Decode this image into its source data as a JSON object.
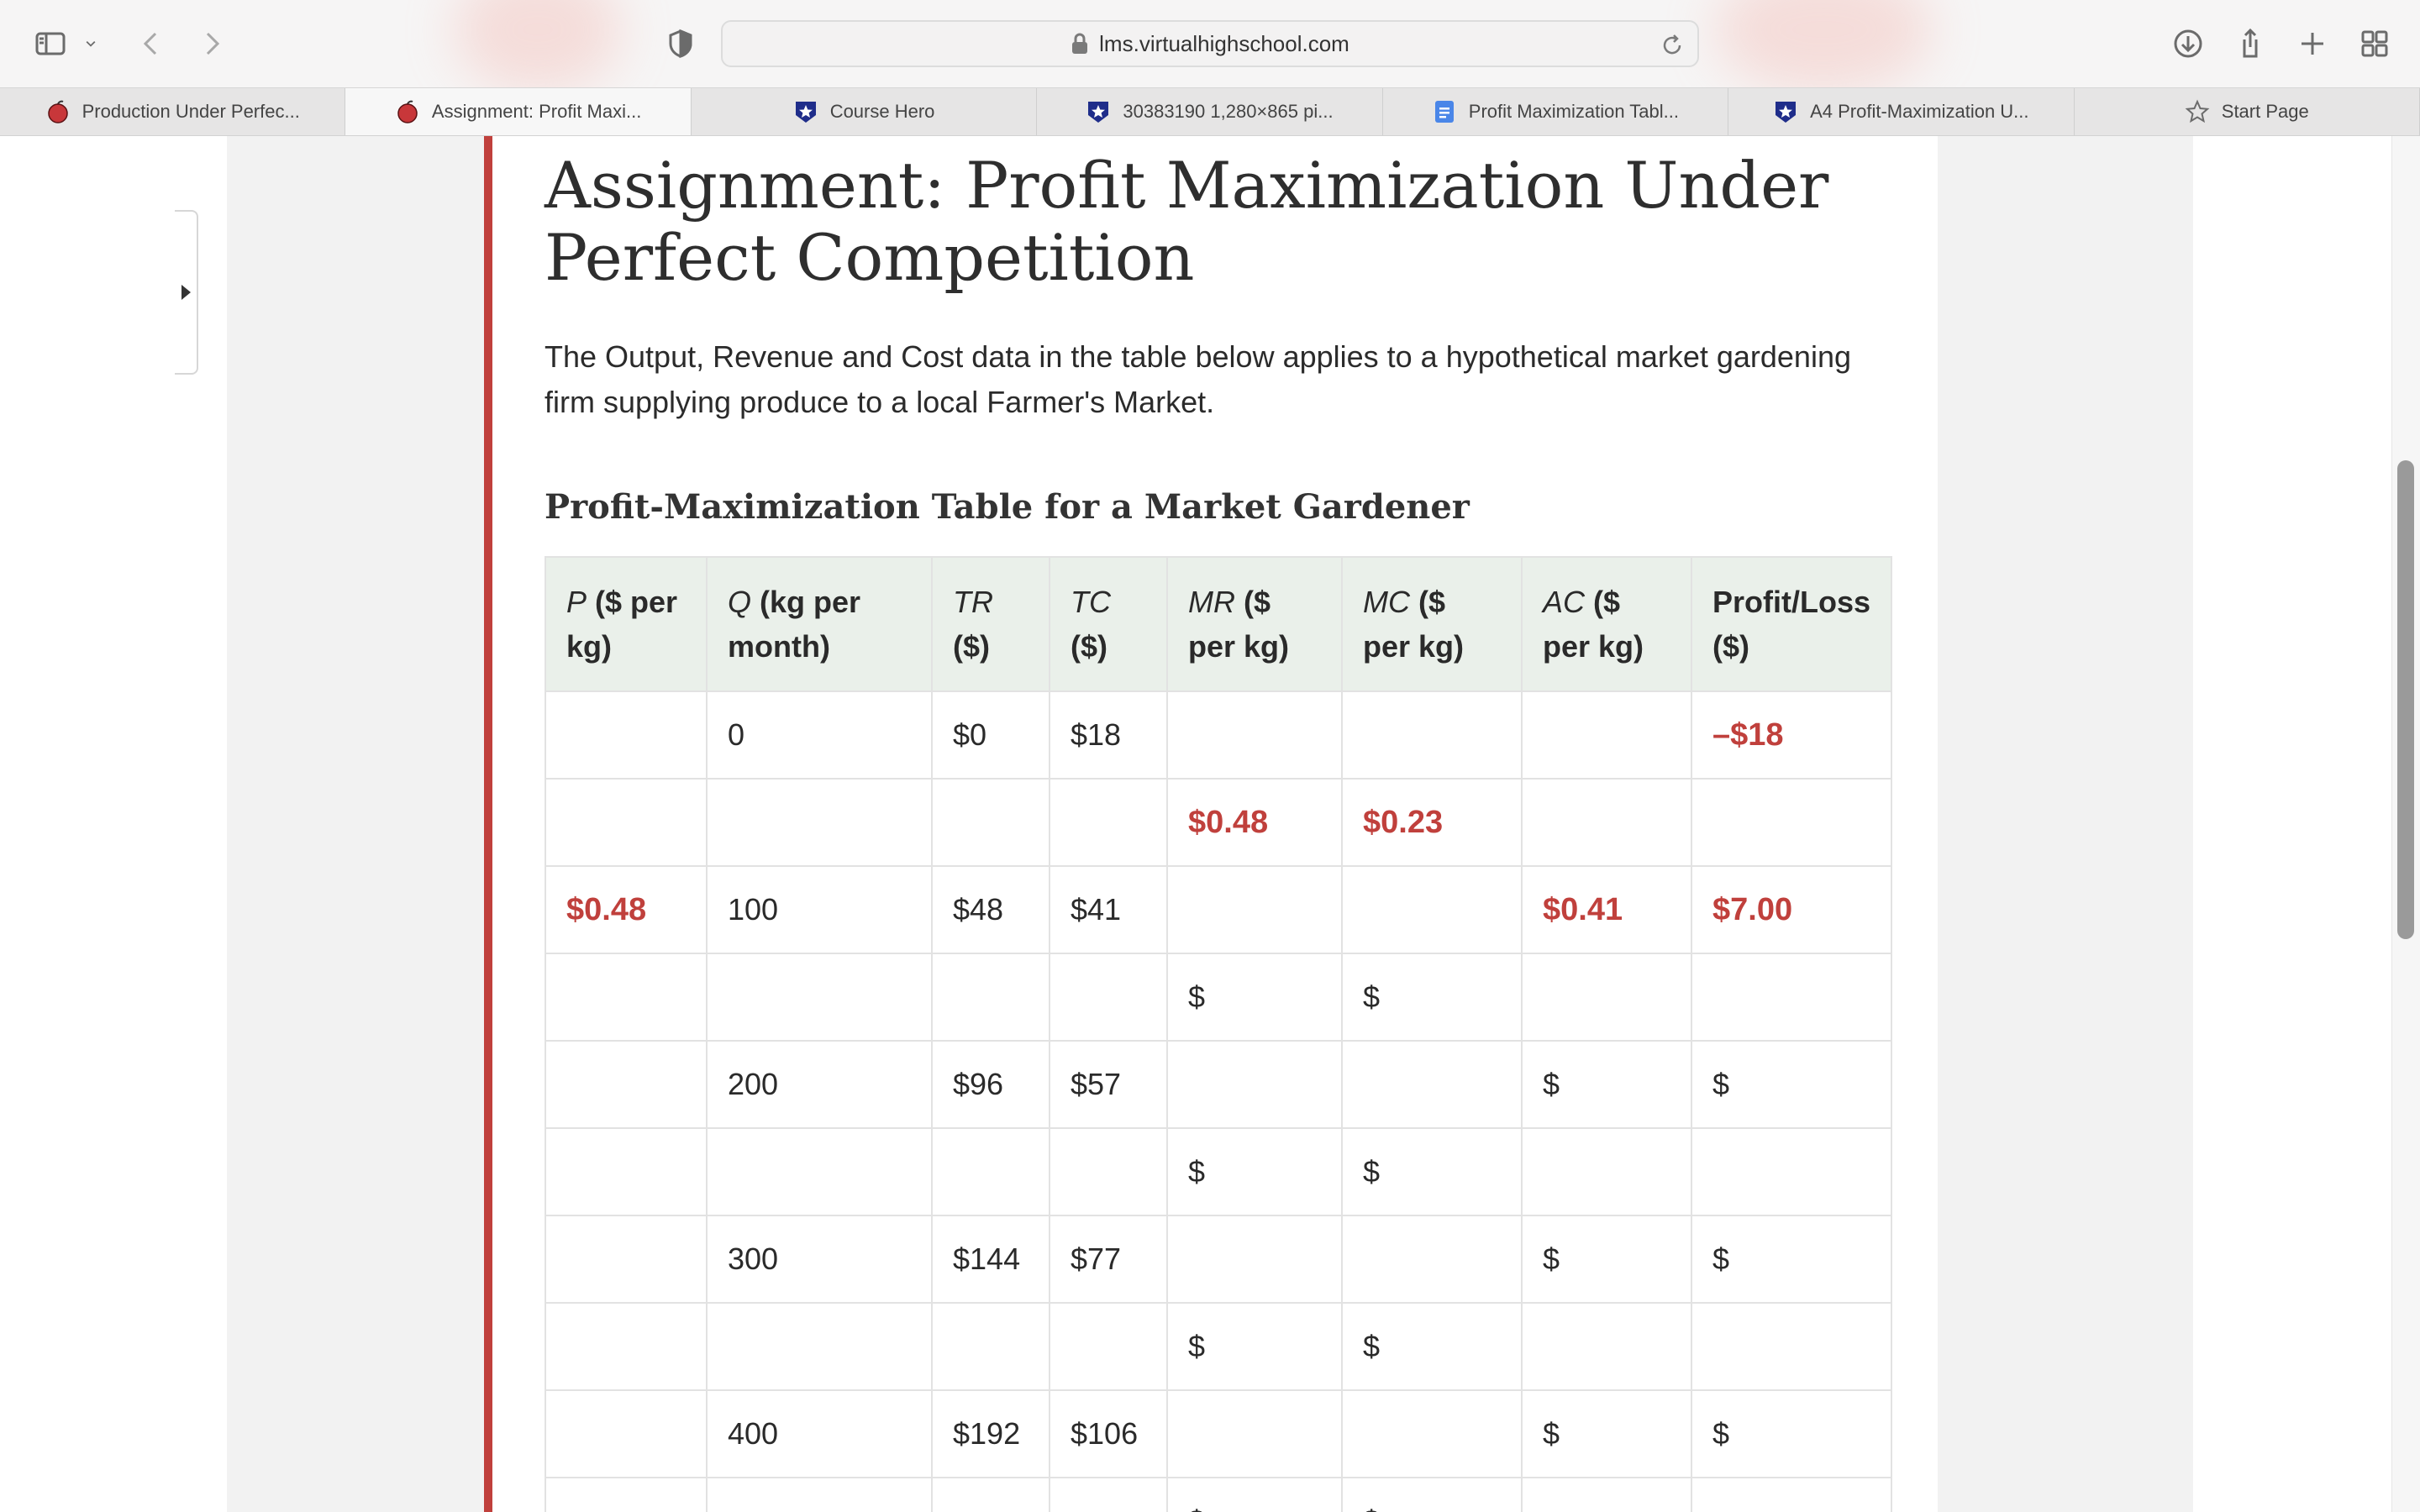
{
  "browser": {
    "url": "lms.virtualhighschool.com",
    "tabs": [
      {
        "label": "Production Under Perfec...",
        "icon": "apple-icon",
        "active": false
      },
      {
        "label": "Assignment: Profit Maxi...",
        "icon": "apple-icon",
        "active": true
      },
      {
        "label": "Course Hero",
        "icon": "star-shield-icon",
        "active": false
      },
      {
        "label": "30383190 1,280×865 pi...",
        "icon": "star-shield-icon",
        "active": false
      },
      {
        "label": "Profit Maximization Tabl...",
        "icon": "doc-icon",
        "active": false
      },
      {
        "label": "A4 Profit-Maximization U...",
        "icon": "star-shield-icon",
        "active": false
      },
      {
        "label": "Start Page",
        "icon": "star-outline-icon",
        "active": false
      }
    ]
  },
  "page": {
    "title": "Assignment: Profit Maximization Under Perfect Competition",
    "intro": "The Output, Revenue and Cost data in the table below applies to a hypothetical market gardening firm supplying produce to a local Farmer's Market.",
    "table_title": "Profit-Maximization Table for a Market Gardener",
    "accent_color": "#c0403c",
    "table": {
      "headers": [
        {
          "sym": "P",
          "rest": " ($ per kg)"
        },
        {
          "sym": "Q",
          "rest": " (kg per month)"
        },
        {
          "sym": "TR",
          "rest": " ($)"
        },
        {
          "sym": "TC",
          "rest": " ($)"
        },
        {
          "sym": "MR",
          "rest": " ($ per kg)"
        },
        {
          "sym": "MC",
          "rest": "  ($ per kg)"
        },
        {
          "sym": "AC",
          "rest": " ($ per kg)"
        },
        {
          "sym": "",
          "rest": "Profit/Loss ($)"
        }
      ],
      "rows": [
        [
          "",
          "0",
          "$0",
          "$18",
          "",
          "",
          "",
          "–$18"
        ],
        [
          "",
          "",
          "",
          "",
          "$0.48",
          "$0.23",
          "",
          ""
        ],
        [
          "$0.48",
          "100",
          "$48",
          "$41",
          "",
          "",
          "$0.41",
          "$7.00"
        ],
        [
          "",
          "",
          "",
          "",
          "$",
          "$",
          "",
          ""
        ],
        [
          "",
          "200",
          "$96",
          "$57",
          "",
          "",
          "$",
          "$"
        ],
        [
          "",
          "",
          "",
          "",
          "$",
          "$",
          "",
          ""
        ],
        [
          "",
          "300",
          "$144",
          "$77",
          "",
          "",
          "$",
          "$"
        ],
        [
          "",
          "",
          "",
          "",
          "$",
          "$",
          "",
          ""
        ],
        [
          "",
          "400",
          "$192",
          "$106",
          "",
          "",
          "$",
          "$"
        ],
        [
          "",
          "",
          "",
          "",
          "$",
          "$",
          "",
          ""
        ]
      ],
      "highlight": [
        [
          0,
          7
        ],
        [
          1,
          4
        ],
        [
          1,
          5
        ],
        [
          2,
          0
        ],
        [
          2,
          6
        ],
        [
          2,
          7
        ]
      ]
    }
  }
}
